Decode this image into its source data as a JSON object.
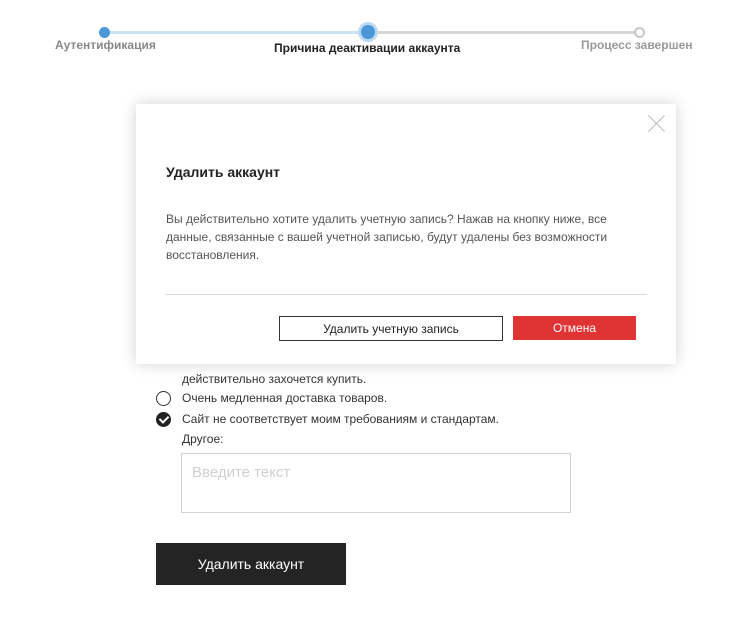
{
  "stepper": {
    "steps": [
      {
        "label": "Аутентификация",
        "state": "done"
      },
      {
        "label": "Причина деактивации аккаунта",
        "state": "current"
      },
      {
        "label": "Процесс завершен",
        "state": "pending"
      }
    ],
    "colors": {
      "active": "#4a98d8",
      "done_line": "#c9e2f4",
      "pending_line": "#d6d6d6"
    }
  },
  "form": {
    "partial_option_text": "действительно захочется купить.",
    "options": [
      {
        "label": "Очень медленная доставка товаров.",
        "checked": false
      },
      {
        "label": "Сайт не соответствует моим требованиям и стандартам.",
        "checked": true
      }
    ],
    "other_label": "Другое:",
    "other_placeholder": "Введите текст",
    "delete_button": "Удалить аккаунт"
  },
  "modal": {
    "title": "Удалить аккаунт",
    "text": "Вы действительно хотите удалить учетную запись? Нажав на кнопку ниже, все данные, связанные с вашей учетной записью, будут удалены без возможности восстановления.",
    "confirm_button": "Удалить учетную запись",
    "cancel_button": "Отмена",
    "close_icon": "close-icon",
    "colors": {
      "cancel_bg": "#e03333"
    }
  }
}
